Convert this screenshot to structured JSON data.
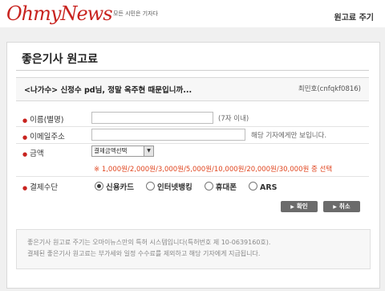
{
  "header": {
    "logo_text": "OhmyNews",
    "tagline": "모든 시민은 기자다",
    "page_label": "원고료 주기"
  },
  "main": {
    "heading": "좋은기사 원고료"
  },
  "article": {
    "title": "<나가수> 신정수 pd님, 정말 옥주현 때문입니까...",
    "author": "최민호(cnfqkf0816)"
  },
  "form": {
    "name_label": "이름(별명)",
    "name_value": "",
    "name_hint": "(7자 이내)",
    "email_label": "이메일주소",
    "email_value": "",
    "email_hint": "해당 기자에게만 보입니다.",
    "amount_label": "금액",
    "amount_selected": "결제금액선택",
    "amount_options_text": "※ 1,000원/2,000원/3,000원/5,000원/10,000원/20,000원/30,000원 중 선택",
    "payment_label": "결제수단",
    "payment_methods": [
      {
        "label": "신용카드",
        "selected": true
      },
      {
        "label": "인터넷뱅킹",
        "selected": false
      },
      {
        "label": "휴대폰",
        "selected": false
      },
      {
        "label": "ARS",
        "selected": false
      }
    ],
    "confirm_label": "확인",
    "cancel_label": "취소"
  },
  "footer": {
    "line1": "좋은기사 원고료 주기는 오마이뉴스만의 특허 시스템입니다(특허번호 제 10-0639160호).",
    "line2": "결제된 좋은기사 원고료는 부가세와 일정 수수료를 제외하고 해당 기자에게 지급됩니다."
  },
  "colors": {
    "brand_red": "#c8231f",
    "amount_orange": "#e0451f",
    "button_gray": "#6b6b6b"
  }
}
